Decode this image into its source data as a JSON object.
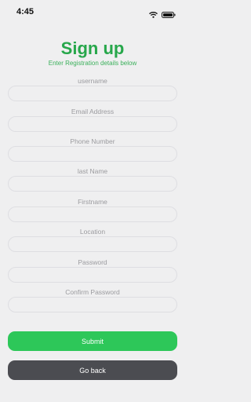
{
  "status_bar": {
    "time": "4:45"
  },
  "header": {
    "title": "Sign up",
    "subtitle": "Enter Registration details below"
  },
  "form": {
    "fields": [
      {
        "label": "username",
        "value": ""
      },
      {
        "label": "Email Address",
        "value": ""
      },
      {
        "label": "Phone Number",
        "value": ""
      },
      {
        "label": "last Name",
        "value": ""
      },
      {
        "label": "Firstname",
        "value": ""
      },
      {
        "label": "Location",
        "value": ""
      },
      {
        "label": "Password",
        "value": ""
      },
      {
        "label": "Confirm Password",
        "value": ""
      }
    ]
  },
  "buttons": {
    "submit_label": "Submit",
    "back_label": "Go back"
  },
  "colors": {
    "accent": "#27a74b",
    "submit_button": "#2dc759",
    "back_button": "#4b4c51",
    "background": "#efeff0"
  }
}
